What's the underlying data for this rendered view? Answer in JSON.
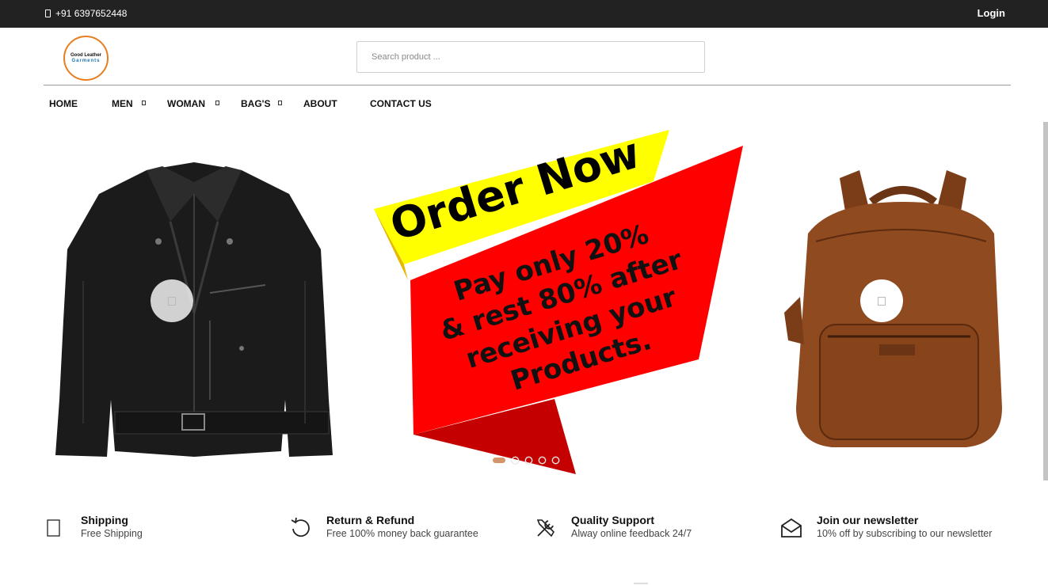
{
  "topbar": {
    "phone": "+91 6397652448",
    "phone_icon": "mobile-phone-icon",
    "login_label": "Login"
  },
  "logo": {
    "line1": "Good Leather",
    "line2": "Garments",
    "accent_color": "#e67e22"
  },
  "search": {
    "placeholder": "Search product ..."
  },
  "nav": {
    "items": [
      {
        "label": "HOME"
      },
      {
        "label": "MEN",
        "dropdown": true
      },
      {
        "label": "WOMAN",
        "dropdown": true
      },
      {
        "label": "BAG'S",
        "dropdown": true
      },
      {
        "label": "ABOUT"
      },
      {
        "label": "CONTACT US"
      }
    ]
  },
  "banner": {
    "headline": "Order Now",
    "offer_lines": [
      "Pay only 20%",
      "& rest 80% after",
      "receiving your",
      "Products."
    ],
    "colors": {
      "yellow": "#ffff00",
      "red": "#ff0000",
      "dark_red": "#c40000"
    }
  },
  "slider": {
    "dots_count": 5,
    "active_dot": 0,
    "active_color": "#d4956a"
  },
  "features": [
    {
      "icon": "box-icon",
      "title": "Shipping",
      "desc": "Free Shipping"
    },
    {
      "icon": "refresh-icon",
      "title": "Return & Refund",
      "desc": "Free 100% money back guarantee"
    },
    {
      "icon": "tools-icon",
      "title": "Quality Support",
      "desc": "Alway online feedback 24/7"
    },
    {
      "icon": "envelope-open-icon",
      "title": "Join our newsletter",
      "desc": "10% off by subscribing to our newsletter"
    }
  ]
}
